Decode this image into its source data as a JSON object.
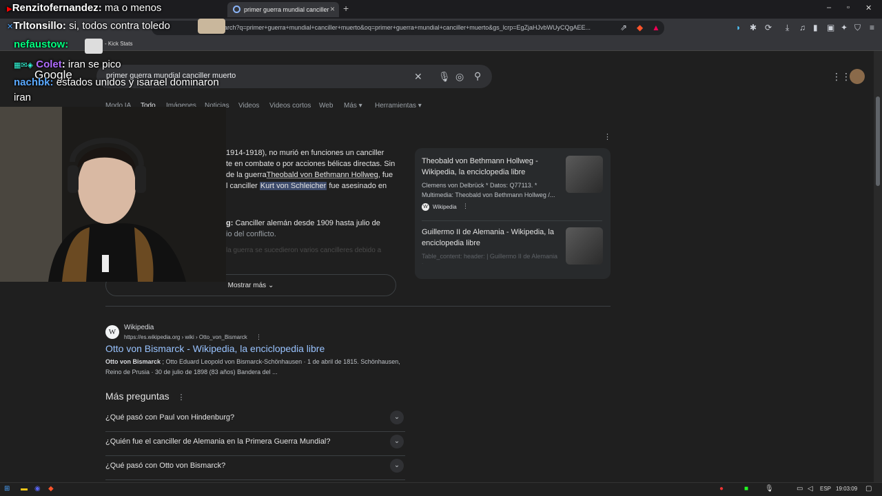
{
  "browser": {
    "tab_title": "primer guerra mundial canciller",
    "url": "earch?q=primer+guerra+mundial+canciller+muerto&oq=primer+guerra+mundial+canciller+muerto&gs_lcrp=EgZjaHJvbWUyCQgAEE...",
    "bookmark_label": "- Kick Stats"
  },
  "search": {
    "query": "primer guerra mundial canciller muerto",
    "tabs": [
      "Modo IA",
      "Todo",
      "Imágenes",
      "Noticias",
      "Videos",
      "Videos cortos",
      "Web",
      "Más",
      "Herramientas"
    ],
    "active_tab": "Todo"
  },
  "answer": {
    "line1": "1914-1918), no murió en funciones un canciller",
    "line2": "te en combate o por acciones bélicas directas. Sin",
    "line3_pre": "de la guerra",
    "line3_link": "Theobald von Bethmann Hollweg",
    "line3_post": ", fue",
    "line4_pre": "l canciller ",
    "line4_hl": "Kurt von Schleicher",
    "line4_post": " fue asesinado en",
    "line5_bold": "g:",
    "line5_text": " Canciller alemán desde 1909 hasta julio de",
    "line6": "io del conflicto.",
    "line7": "la guerra se sucedieron varios cancilleres debido a",
    "show_more": "Mostrar más"
  },
  "cards": [
    {
      "title": "Theobald von Bethmann Hollweg - Wikipedia, la enciclopedia libre",
      "snippet": "Clemens von Delbrück * Datos: Q77113. * Multimedia: Theobald von Bethmann Hollweg /...",
      "source": "Wikipedia"
    },
    {
      "title": "Guillermo II de Alemania - Wikipedia, la enciclopedia libre",
      "snippet": "Table_content: header: | Guillermo II de Alemania |"
    }
  ],
  "result": {
    "site": "Wikipedia",
    "url": "https://es.wikipedia.org › wiki › Otto_von_Bismarck",
    "title": "Otto von Bismarck - Wikipedia, la enciclopedia libre",
    "snippet_bold": "Otto von Bismarck",
    "snippet": " ; Otto Eduard Leopold von Bismarck-Schönhausen · 1 de abril de 1815. Schönhausen, Reino de Prusia · 30 de julio de 1898 (83 años) Bandera del ..."
  },
  "paa": {
    "title": "Más preguntas",
    "questions": [
      "¿Qué pasó con Paul von Hindenburg?",
      "¿Quién fue el canciller de Alemania en la Primera Guerra Mundial?",
      "¿Qué pasó con Otto von Bismarck?"
    ]
  },
  "chat": [
    {
      "user": "Renzitofernandez",
      "text": "ma o menos",
      "color": "#ffffff"
    },
    {
      "user": "Trltonsillo",
      "text": "si, todos contra toledo",
      "color": "#ffffff"
    },
    {
      "user": "nefaustow",
      "text": "",
      "color": "#00ff7f"
    },
    {
      "user": "Colet",
      "text": "iran se pico",
      "color": "#b06cff"
    },
    {
      "user": "nachbk",
      "text": "estados unidos y isarael dominaron",
      "color": "#5aa9ff"
    },
    {
      "user": "",
      "text": "iran",
      "color": "#ffffff"
    }
  ],
  "overlay_logo": "Google",
  "taskbar": {
    "lang": "ESP",
    "time": "19:03:09"
  }
}
